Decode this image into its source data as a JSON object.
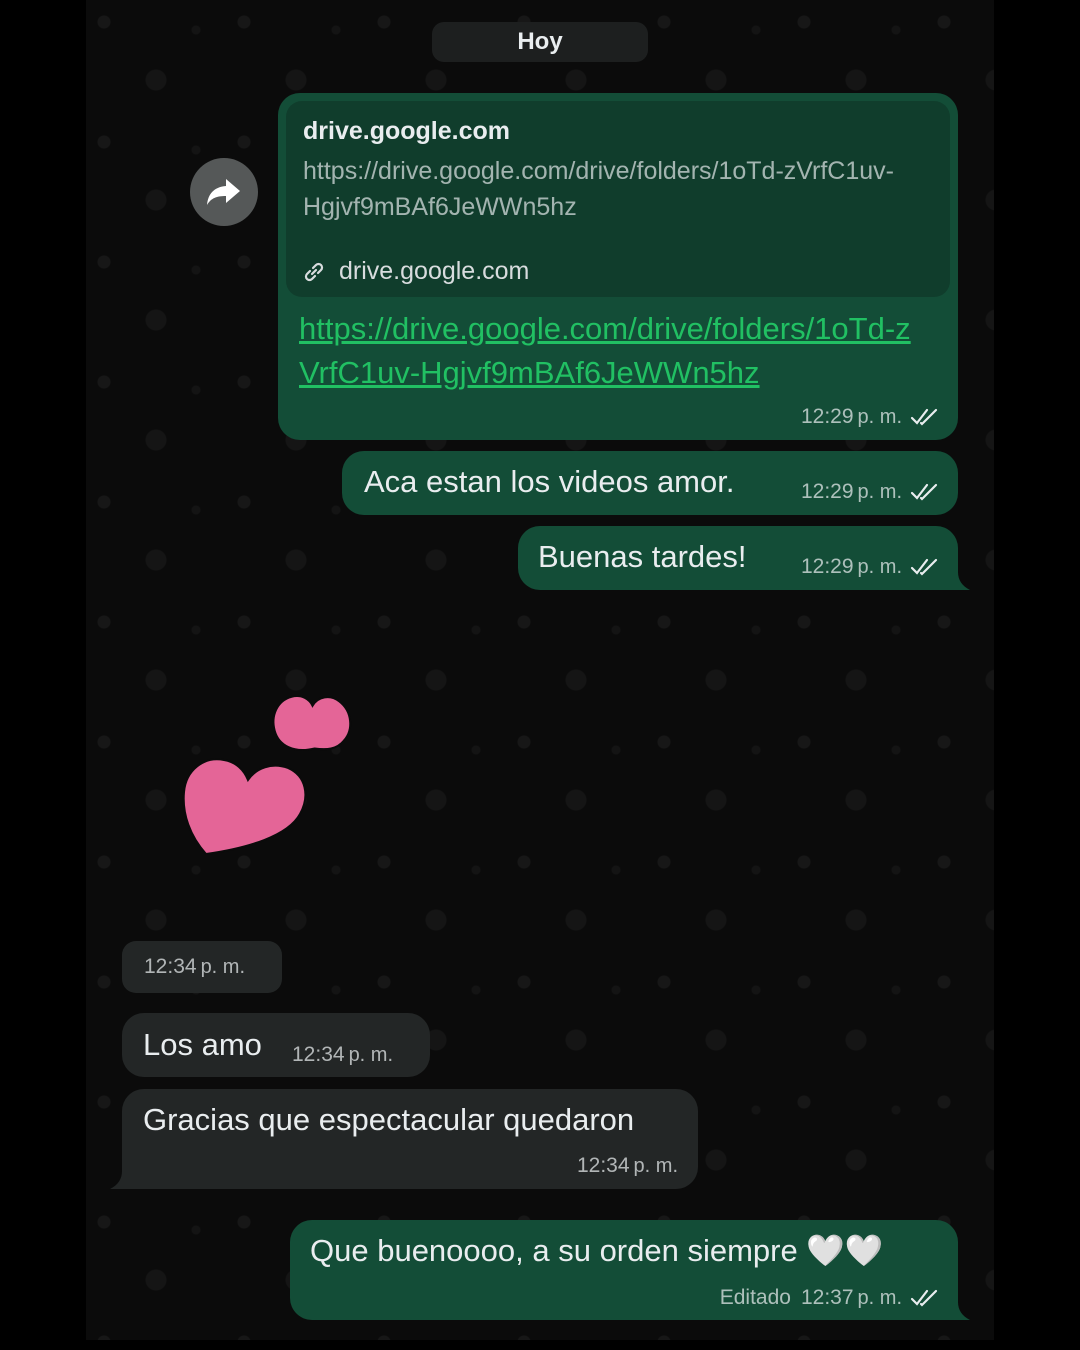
{
  "date_label": "Hoy",
  "colors": {
    "outgoing_bubble": "#134d37",
    "incoming_bubble": "#232626",
    "link_green": "#21c063",
    "read_ticks": "#e9edef",
    "heart_pink": "#e46597"
  },
  "messages": {
    "link": {
      "preview_domain": "drive.google.com",
      "preview_url": "https://drive.google.com/drive/folders/1oTd-zVrfC1uv-Hgjvf9mBAf6JeWWn5hz",
      "preview_footer_domain": "drive.google.com",
      "link_text": "https://drive.google.com/drive/folders/1oTd-zVrfC1uv-Hgjvf9mBAf6JeWWn5hz",
      "time": "12:29",
      "ampm": "p. m."
    },
    "videos": {
      "text": "Aca estan los videos amor.",
      "time": "12:29",
      "ampm": "p. m."
    },
    "tardes": {
      "text": "Buenas tardes!",
      "time": "12:29",
      "ampm": "p. m."
    },
    "sticker": {
      "icon": "two-pink-hearts-sticker",
      "time": "12:34",
      "ampm": "p. m."
    },
    "losamo": {
      "text": "Los amo",
      "time": "12:34",
      "ampm": "p. m."
    },
    "gracias": {
      "text": "Gracias que espectacular quedaron",
      "time": "12:34",
      "ampm": "p. m."
    },
    "bueno": {
      "text": "Que buenoooo, a su orden siempre 🤍🤍",
      "edited": "Editado",
      "time": "12:37",
      "ampm": "p. m."
    }
  },
  "icons": {
    "forward": "forward-arrow-icon",
    "link": "link-icon",
    "read": "double-check-icon"
  }
}
